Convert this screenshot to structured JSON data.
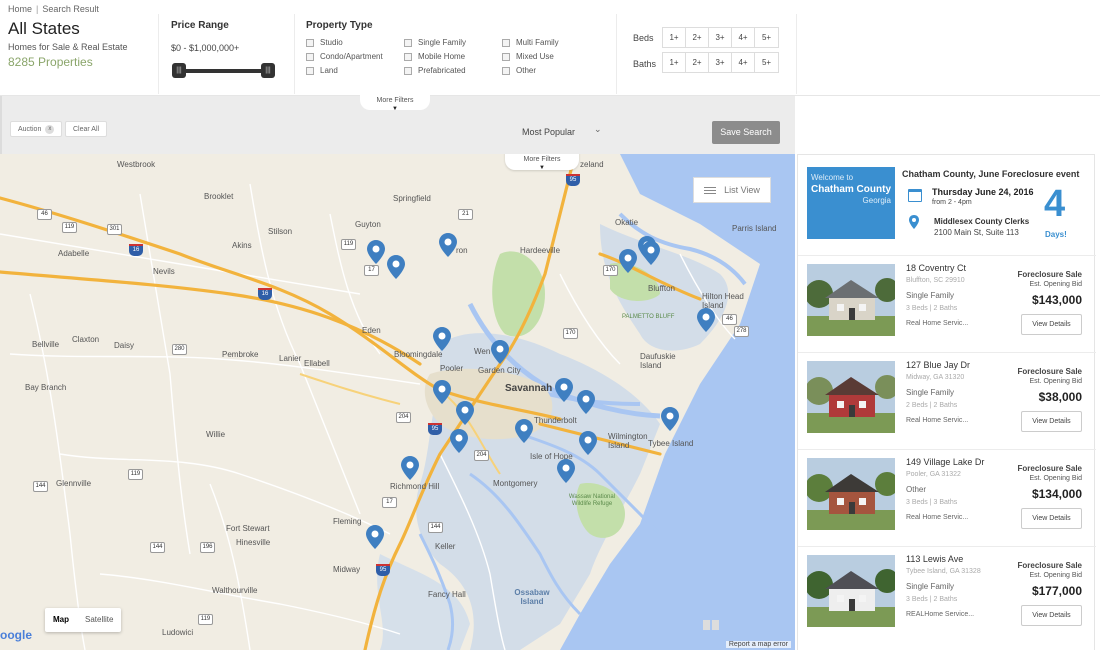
{
  "breadcrumb": {
    "home": "Home",
    "sep": "|",
    "current": "Search Result"
  },
  "header": {
    "title": "All States",
    "subtitle": "Homes for Sale & Real Estate",
    "count": "8285 Properties"
  },
  "price": {
    "label": "Price Range",
    "range": "$0 - $1,000,000+",
    "min_fraction": 0.0,
    "max_fraction": 1.0
  },
  "property_type": {
    "label": "Property Type",
    "options": [
      "Studio",
      "Condo/Apartment",
      "Land",
      "Single Family",
      "Mobile Home",
      "Prefabricated",
      "Multi Family",
      "Mixed Use",
      "Other"
    ]
  },
  "beds": {
    "label": "Beds",
    "options": [
      "1+",
      "2+",
      "3+",
      "4+",
      "5+"
    ]
  },
  "baths": {
    "label": "Baths",
    "options": [
      "1+",
      "2+",
      "3+",
      "4+",
      "5+"
    ]
  },
  "chips": {
    "more_filters": "More Filters",
    "auction": "Auction",
    "auction_x": "x",
    "clear_all": "Clear All"
  },
  "sort": {
    "value": "Most Popular"
  },
  "save_search": "Save Search",
  "map": {
    "more_filters": "More Filters",
    "list_view": "List View",
    "type_map": "Map",
    "type_satellite": "Satellite",
    "google": "oogle",
    "report": "Report a map error",
    "places": {
      "westbrook": "Westbrook",
      "brooklet": "Brooklet",
      "springfield": "Springfield",
      "guyton": "Guyton",
      "stilson": "Stilson",
      "akins": "Akins",
      "adabelle": "Adabelle",
      "nevils": "Nevils",
      "hardeeville": "Hardeeville",
      "okatie": "Okatie",
      "parris": "Parris Island",
      "bluffton": "Bluffton",
      "hilton": "Hilton Head Island",
      "palmetto": "PALMETTO BLUFF",
      "daufuskie": "Daufuskie Island",
      "eden": "Eden",
      "bloomingdale": "Bloomingdale",
      "pooler": "Pooler",
      "garden": "Garden City",
      "savannah": "Savannah",
      "thunderbolt": "Thunderbolt",
      "isle": "Isle of Hope",
      "tybee": "Tybee Island",
      "wilmington": "Wilmington Island",
      "montgomery": "Montgomery",
      "wassaw": "Wassaw National Wildlife Refuge",
      "richmond": "Richmond Hill",
      "ossabaw": "Ossabaw Island",
      "fleming": "Fleming",
      "midway": "Midway",
      "keller": "Keller",
      "fancy": "Fancy Hall",
      "fortstewart": "Fort Stewart",
      "hinesville": "Hinesville",
      "walthourville": "Walthourville",
      "ludowici": "Ludowici",
      "willie": "Willie",
      "glennville": "Glennville",
      "baybranch": "Bay Branch",
      "bellville": "Bellville",
      "claxton": "Claxton",
      "daisy": "Daisy",
      "pembroke": "Pembroke",
      "lanier": "Lanier",
      "ellabell": "Ellabell",
      "zeland": "zeland",
      "ron": "ron",
      "wen": "Wen"
    }
  },
  "event": {
    "welcome": "Welcome to",
    "county": "Chatham County",
    "state": "Georgia",
    "title": "Chatham County, June Foreclosure event",
    "date": "Thursday June 24, 2016",
    "time": "from 2 - 4pm",
    "place": "Middlesex County Clerks",
    "address": "2100 Main St, Suite 113",
    "days_num": "4",
    "days_label": "Days!"
  },
  "listings": [
    {
      "address": "18 Coventry Ct",
      "city": "Bluffton, SC 29910",
      "type": "Single Family",
      "bedbath": "3 Beds | 2 Baths",
      "agent": "Real Home Servic...",
      "sale": "Foreclosure Sale",
      "bid": "Est. Opening Bid",
      "price": "$143,000",
      "details": "View Details",
      "roof": "#6b6f72",
      "wall": "#d9d4c8",
      "tree": "#4d6b3a"
    },
    {
      "address": "127 Blue Jay Dr",
      "city": "Midway, GA 31320",
      "type": "Single Family",
      "bedbath": "2 Beds | 2 Baths",
      "agent": "Real Home Servic...",
      "sale": "Foreclosure Sale",
      "bid": "Est. Opening Bid",
      "price": "$38,000",
      "details": "View Details",
      "roof": "#5a3b35",
      "wall": "#b03a3a",
      "tree": "#7a8f5a"
    },
    {
      "address": "149 Village Lake Dr",
      "city": "Pooler, GA 31322",
      "type": "Other",
      "bedbath": "3 Beds | 3 Baths",
      "agent": "Real Home Servic...",
      "sale": "Foreclosure Sale",
      "bid": "Est. Opening Bid",
      "price": "$134,000",
      "details": "View Details",
      "roof": "#3d3a37",
      "wall": "#a5553e",
      "tree": "#5c7e3c"
    },
    {
      "address": "113 Lewis Ave",
      "city": "Tybee Island, GA 31328",
      "type": "Single Family",
      "bedbath": "3 Beds | 2 Baths",
      "agent": "REALHome Service...",
      "sale": "Foreclosure Sale",
      "bid": "Est. Opening Bid",
      "price": "$177,000",
      "details": "View Details",
      "roof": "#4f4f55",
      "wall": "#eeeeee",
      "tree": "#3f6430"
    }
  ],
  "colors": {
    "accent": "#3a8fd0",
    "count_green": "#8aa56a",
    "pin": "#3f7fc1",
    "save_btn": "#8c8c8c"
  }
}
